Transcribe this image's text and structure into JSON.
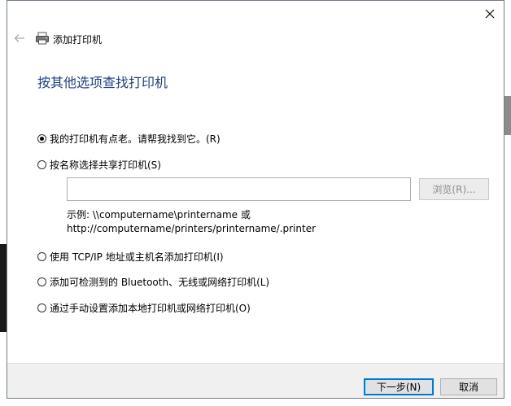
{
  "header": {
    "title": "添加打印机"
  },
  "page": {
    "title": "按其他选项查找打印机"
  },
  "options": [
    {
      "label": "我的打印机有点老。请帮我找到它。(R)",
      "checked": true
    },
    {
      "label": "按名称选择共享打印机(S)",
      "checked": false
    },
    {
      "label": "使用 TCP/IP 地址或主机名添加打印机(I)",
      "checked": false
    },
    {
      "label": "添加可检测到的 Bluetooth、无线或网络打印机(L)",
      "checked": false
    },
    {
      "label": "通过手动设置添加本地打印机或网络打印机(O)",
      "checked": false
    }
  ],
  "share": {
    "input_value": "",
    "browse_label": "浏览(R)...",
    "example_line1": "示例: \\\\computername\\printername 或",
    "example_line2": "http://computername/printers/printername/.printer"
  },
  "footer": {
    "next_label": "下一步(N)",
    "cancel_label": "取消"
  },
  "colors": {
    "title_blue": "#1e3e87",
    "focus_blue": "#0078d7"
  }
}
